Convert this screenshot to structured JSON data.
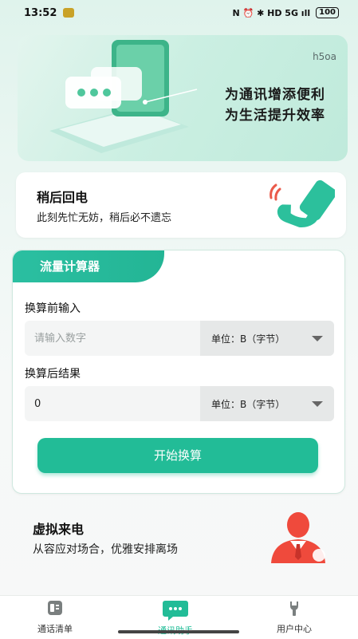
{
  "status_bar": {
    "time": "13:52",
    "icons": "N ⏰ ✱ HD 5G ıll",
    "battery": "100"
  },
  "banner": {
    "tag": "h5oa",
    "line1": "为通讯增添便利",
    "line2": "为生活提升效率"
  },
  "callback": {
    "title": "稍后回电",
    "desc": "此刻先忙无妨，稍后必不遗忘",
    "icon": "phone-ringing-icon"
  },
  "calculator": {
    "tab": "流量计算器",
    "input_label": "换算前输入",
    "input_placeholder": "请输入数字",
    "input_unit": "单位：B（字节）",
    "output_label": "换算后结果",
    "output_value": "0",
    "output_unit": "单位：B（字节）",
    "button": "开始换算"
  },
  "virtual_call": {
    "title": "虚拟来电",
    "desc": "从容应对场合，优雅安排离场",
    "icon": "businessman-icon"
  },
  "tabbar": {
    "tabs": [
      {
        "label": "通话清单",
        "icon": "call-list-icon"
      },
      {
        "label": "通讯助手",
        "icon": "chat-bubble-icon"
      },
      {
        "label": "用户中心",
        "icon": "wrench-icon"
      }
    ],
    "active": 1
  },
  "colors": {
    "accent": "#22bc97",
    "background": "#eef7f4"
  }
}
